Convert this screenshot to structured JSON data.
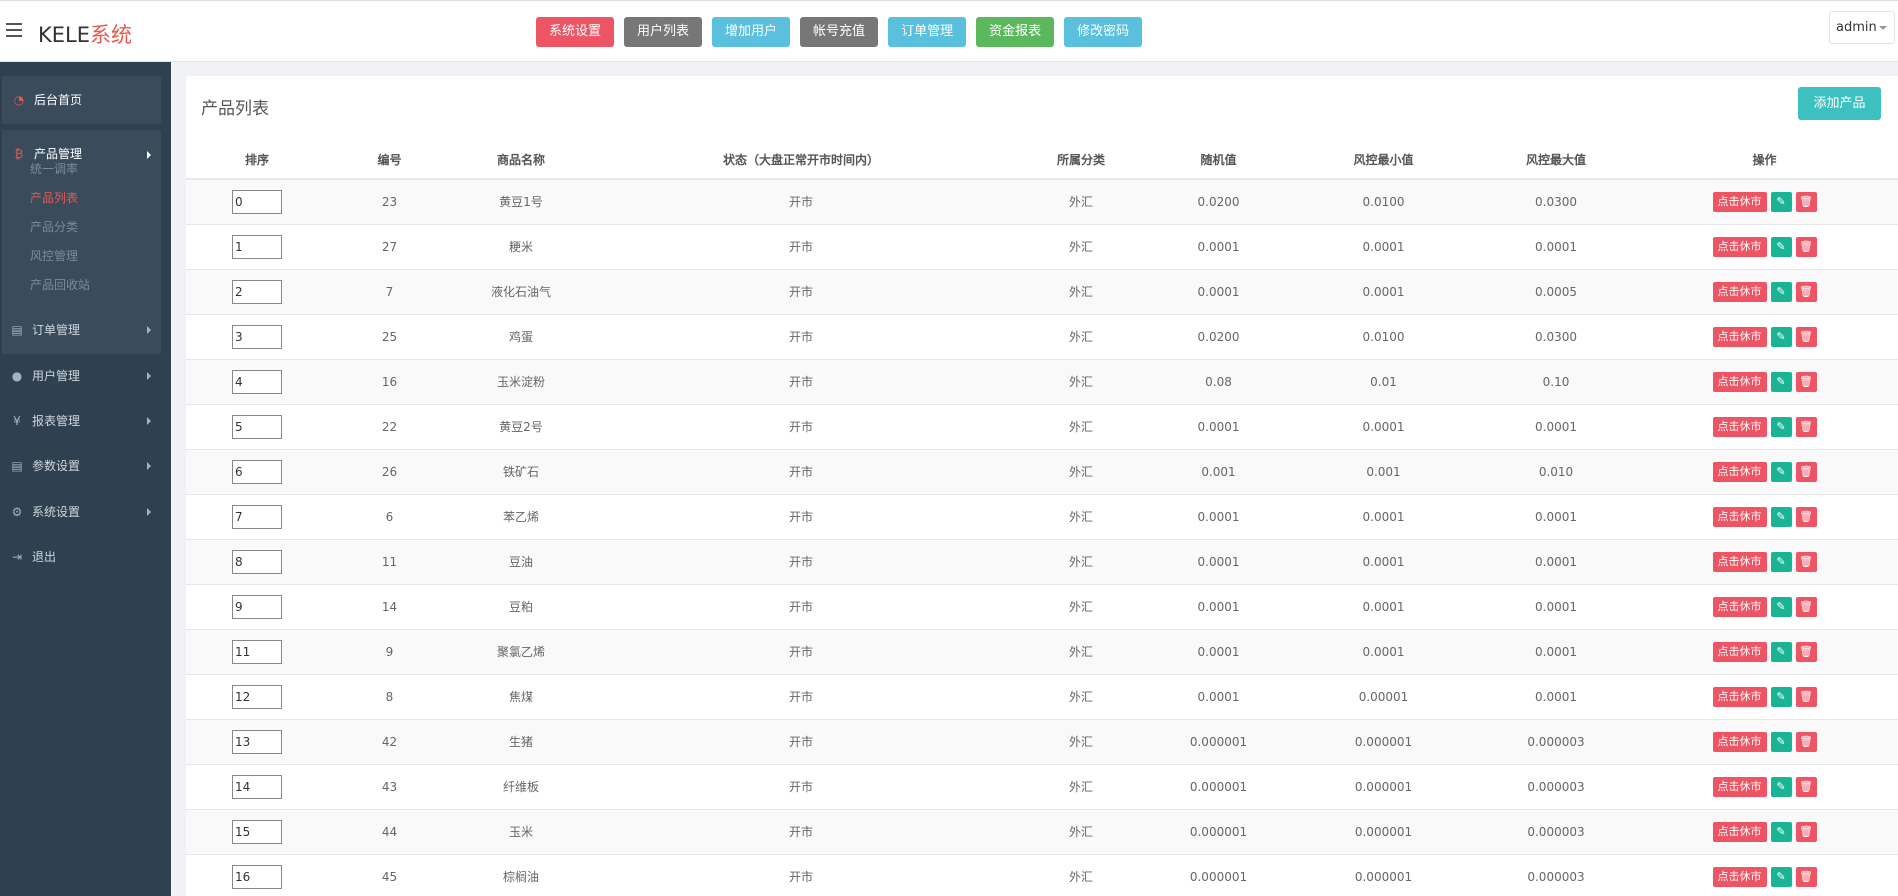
{
  "header": {
    "logo_a": "KELE",
    "logo_b": "系统",
    "menu_icon": "hamburger-icon",
    "nav_buttons": [
      {
        "label": "系统设置",
        "color": "#ed5565"
      },
      {
        "label": "用户列表",
        "color": "#777777"
      },
      {
        "label": "增加用户",
        "color": "#5bc0de"
      },
      {
        "label": "帐号充值",
        "color": "#777777"
      },
      {
        "label": "订单管理",
        "color": "#5bc0de"
      },
      {
        "label": "资金报表",
        "color": "#5cb85c"
      },
      {
        "label": "修改密码",
        "color": "#5bc0de"
      }
    ],
    "user": "admin"
  },
  "sidebar": {
    "home": {
      "label": "后台首页",
      "icon": "dashboard-icon"
    },
    "product": {
      "label": "产品管理",
      "icon": "bitcoin-icon"
    },
    "product_subitems": [
      "统一调率",
      "产品列表",
      "产品分类",
      "风控管理",
      "产品回收站"
    ],
    "active_subitem": "产品列表",
    "items": [
      {
        "label": "订单管理",
        "icon": "copy-icon"
      },
      {
        "label": "用户管理",
        "icon": "user-icon"
      },
      {
        "label": "报表管理",
        "icon": "yen-icon"
      },
      {
        "label": "参数设置",
        "icon": "copy-icon"
      },
      {
        "label": "系统设置",
        "icon": "gears-icon"
      },
      {
        "label": "退出",
        "icon": "sign-out-icon"
      }
    ]
  },
  "main": {
    "title": "产品列表",
    "add_button": "添加产品",
    "columns": [
      "排序",
      "编号",
      "商品名称",
      "状态（大盘正常开市时间内）",
      "所属分类",
      "随机值",
      "风控最小值",
      "风控最大值",
      "操作"
    ],
    "action_labels": {
      "rest": "点击休市",
      "edit_icon": "pencil-icon",
      "delete_icon": "trash-icon"
    },
    "rows": [
      {
        "sort": "0",
        "id": "23",
        "name": "黄豆1号",
        "status": "开市",
        "category": "外汇",
        "random": "0.0200",
        "min": "0.0100",
        "max": "0.0300"
      },
      {
        "sort": "1",
        "id": "27",
        "name": "粳米",
        "status": "开市",
        "category": "外汇",
        "random": "0.0001",
        "min": "0.0001",
        "max": "0.0001"
      },
      {
        "sort": "2",
        "id": "7",
        "name": "液化石油气",
        "status": "开市",
        "category": "外汇",
        "random": "0.0001",
        "min": "0.0001",
        "max": "0.0005"
      },
      {
        "sort": "3",
        "id": "25",
        "name": "鸡蛋",
        "status": "开市",
        "category": "外汇",
        "random": "0.0200",
        "min": "0.0100",
        "max": "0.0300"
      },
      {
        "sort": "4",
        "id": "16",
        "name": "玉米淀粉",
        "status": "开市",
        "category": "外汇",
        "random": "0.08",
        "min": "0.01",
        "max": "0.10"
      },
      {
        "sort": "5",
        "id": "22",
        "name": "黄豆2号",
        "status": "开市",
        "category": "外汇",
        "random": "0.0001",
        "min": "0.0001",
        "max": "0.0001"
      },
      {
        "sort": "6",
        "id": "26",
        "name": "铁矿石",
        "status": "开市",
        "category": "外汇",
        "random": "0.001",
        "min": "0.001",
        "max": "0.010"
      },
      {
        "sort": "7",
        "id": "6",
        "name": "苯乙烯",
        "status": "开市",
        "category": "外汇",
        "random": "0.0001",
        "min": "0.0001",
        "max": "0.0001"
      },
      {
        "sort": "8",
        "id": "11",
        "name": "豆油",
        "status": "开市",
        "category": "外汇",
        "random": "0.0001",
        "min": "0.0001",
        "max": "0.0001"
      },
      {
        "sort": "9",
        "id": "14",
        "name": "豆粕",
        "status": "开市",
        "category": "外汇",
        "random": "0.0001",
        "min": "0.0001",
        "max": "0.0001"
      },
      {
        "sort": "11",
        "id": "9",
        "name": "聚氯乙烯",
        "status": "开市",
        "category": "外汇",
        "random": "0.0001",
        "min": "0.0001",
        "max": "0.0001"
      },
      {
        "sort": "12",
        "id": "8",
        "name": "焦煤",
        "status": "开市",
        "category": "外汇",
        "random": "0.0001",
        "min": "0.00001",
        "max": "0.0001"
      },
      {
        "sort": "13",
        "id": "42",
        "name": "生猪",
        "status": "开市",
        "category": "外汇",
        "random": "0.000001",
        "min": "0.000001",
        "max": "0.000003"
      },
      {
        "sort": "14",
        "id": "43",
        "name": "纤维板",
        "status": "开市",
        "category": "外汇",
        "random": "0.000001",
        "min": "0.000001",
        "max": "0.000003"
      },
      {
        "sort": "15",
        "id": "44",
        "name": "玉米",
        "status": "开市",
        "category": "外汇",
        "random": "0.000001",
        "min": "0.000001",
        "max": "0.000003"
      },
      {
        "sort": "16",
        "id": "45",
        "name": "棕榈油",
        "status": "开市",
        "category": "外汇",
        "random": "0.000001",
        "min": "0.000001",
        "max": "0.000003"
      }
    ]
  }
}
